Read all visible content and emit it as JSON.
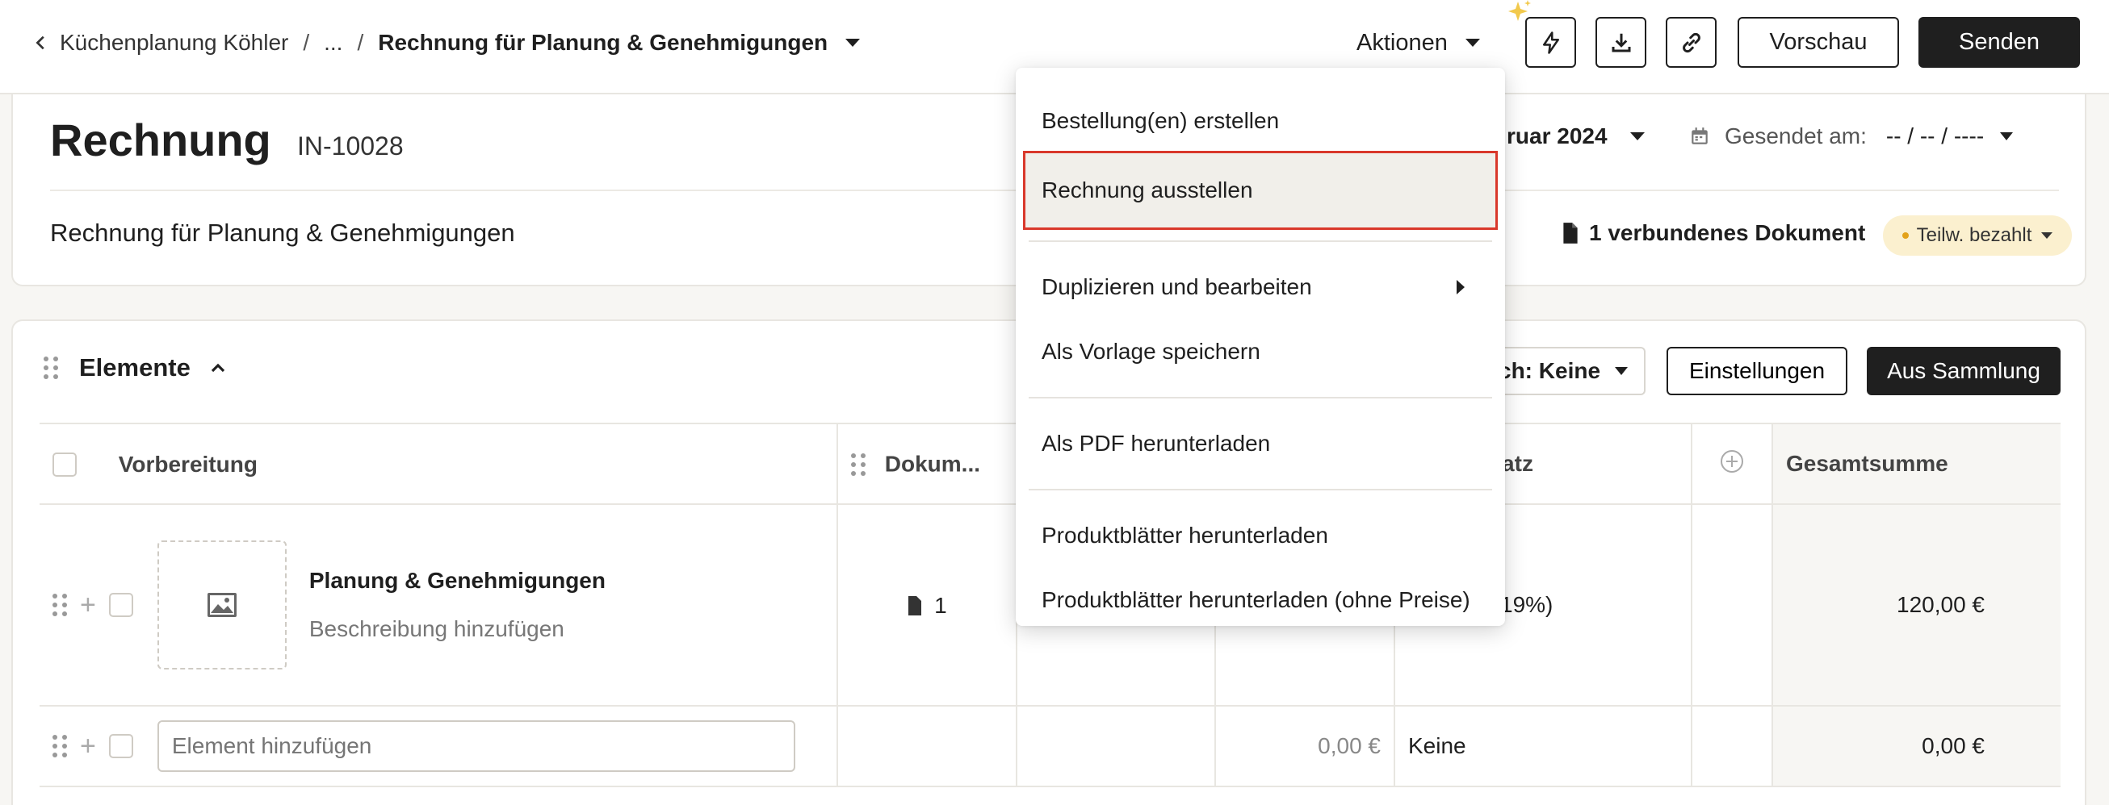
{
  "topbar": {
    "breadcrumb_project": "Küchenplanung Köhler",
    "breadcrumb_ellipsis": "...",
    "breadcrumb_sep": "/",
    "breadcrumb_current": "Rechnung für Planung & Genehmigungen",
    "actions_label": "Aktionen",
    "preview_label": "Vorschau",
    "send_label": "Senden"
  },
  "header": {
    "title": "Rechnung",
    "number": "IN-10028",
    "date_partial": "ruar 2024",
    "sent_label": "Gesendet am:",
    "sent_value": "-- / -- / ----",
    "subtitle": "Rechnung für Planung & Genehmigungen",
    "linked_docs": "1 verbundenes Dokument",
    "status": "Teilw. bezahlt"
  },
  "elements": {
    "section_title": "Elemente",
    "tax_partial": "ch: Keine",
    "settings_label": "Einstellungen",
    "collection_label": "Aus Sammlung",
    "columns": [
      "Vorbereitung",
      "Dokum...",
      "",
      "",
      "ersatz",
      "",
      "Gesamtsumme"
    ],
    "rows": [
      {
        "name": "Planung & Genehmigungen",
        "desc": "Beschreibung hinzufügen",
        "docs": "1",
        "col3": "",
        "price": "",
        "tax": "19%)",
        "total": "120,00 €"
      }
    ],
    "add_row": {
      "placeholder": "Element hinzufügen",
      "price": "0,00 €",
      "tax": "Keine",
      "total": "0,00 €"
    }
  },
  "actions_menu": {
    "items": [
      {
        "label": "Bestellung(en) erstellen"
      },
      {
        "label": "Rechnung ausstellen"
      },
      {
        "label": "Duplizieren und bearbeiten"
      },
      {
        "label": "Als Vorlage speichern"
      },
      {
        "label": "Als PDF herunterladen"
      },
      {
        "label": "Produktblätter herunterladen"
      },
      {
        "label": "Produktblätter herunterladen (ohne Preise)"
      }
    ]
  },
  "colors": {
    "accent_dark": "#1f1f1f",
    "highlight_outline": "#d9382b",
    "status_badge_bg": "#fbf0cf",
    "status_dot": "#e3a21a"
  }
}
